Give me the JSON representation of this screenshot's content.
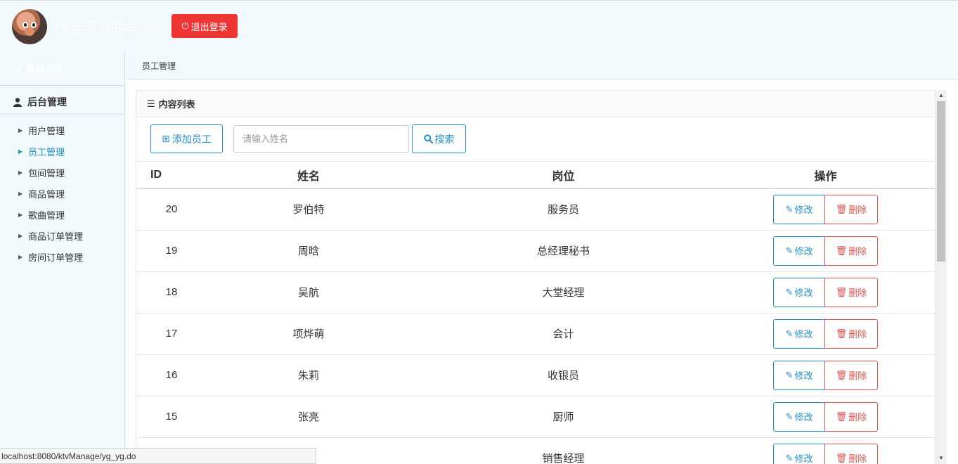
{
  "header": {
    "title": "后台管理中心",
    "logout_label": "退出登录"
  },
  "sidebar": {
    "menu_header": "菜单列表",
    "section_title": "后台管理",
    "items": [
      {
        "label": "用户管理"
      },
      {
        "label": "员工管理"
      },
      {
        "label": "包间管理"
      },
      {
        "label": "商品管理"
      },
      {
        "label": "歌曲管理"
      },
      {
        "label": "商品订单管理"
      },
      {
        "label": "房间订单管理"
      }
    ],
    "active_index": 1
  },
  "breadcrumb": "员工管理",
  "panel": {
    "title": "内容列表",
    "add_label": "添加员工",
    "search_placeholder": "请输入姓名",
    "search_label": "搜索"
  },
  "table": {
    "headers": {
      "id": "ID",
      "name": "姓名",
      "position": "岗位",
      "ops": "操作"
    },
    "edit_label": "修改",
    "delete_label": "删除",
    "rows": [
      {
        "id": "20",
        "name": "罗伯特",
        "position": "服务员"
      },
      {
        "id": "19",
        "name": "周晗",
        "position": "总经理秘书"
      },
      {
        "id": "18",
        "name": "吴航",
        "position": "大堂经理"
      },
      {
        "id": "17",
        "name": "项烨萌",
        "position": "会计"
      },
      {
        "id": "16",
        "name": "朱莉",
        "position": "收银员"
      },
      {
        "id": "15",
        "name": "张亮",
        "position": "厨师"
      },
      {
        "id": "",
        "name": "",
        "position": "销售经理"
      }
    ]
  },
  "status_bar": "localhost:8080/ktvManage/yg_yg.do",
  "colors": {
    "accent": "#2490c9",
    "danger": "#d9534f",
    "logout": "#ef3434",
    "page_bg": "#f2f9fc"
  }
}
